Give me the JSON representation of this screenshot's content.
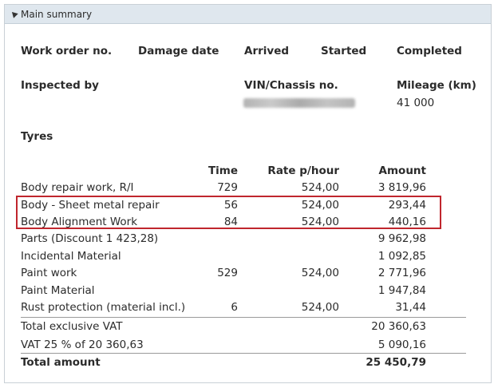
{
  "panel": {
    "title": "Main summary"
  },
  "header_fields": {
    "work_order": "Work order no.",
    "damage_date": "Damage date",
    "arrived": "Arrived",
    "started": "Started",
    "completed": "Completed",
    "inspected_by": "Inspected by",
    "vin": "VIN/Chassis no.",
    "mileage_label": "Mileage (km)",
    "mileage_value": "41 000"
  },
  "tyres_label": "Tyres",
  "columns": {
    "time": "Time",
    "rate": "Rate p/hour",
    "amount": "Amount"
  },
  "rows": [
    {
      "label": "Body repair work, R/I",
      "time": "729",
      "rate": "524,00",
      "amount": "3 819,96"
    },
    {
      "label": "Body - Sheet metal repair",
      "time": "56",
      "rate": "524,00",
      "amount": "293,44"
    },
    {
      "label": "Body Alignment Work",
      "time": "84",
      "rate": "524,00",
      "amount": "440,16"
    },
    {
      "label": "Parts (Discount 1 423,28)",
      "time": "",
      "rate": "",
      "amount": "9 962,98"
    },
    {
      "label": "Incidental Material",
      "time": "",
      "rate": "",
      "amount": "1 092,85"
    },
    {
      "label": "Paint work",
      "time": "529",
      "rate": "524,00",
      "amount": "2 771,96"
    },
    {
      "label": "Paint Material",
      "time": "",
      "rate": "",
      "amount": "1 947,84"
    },
    {
      "label": "Rust protection (material incl.)",
      "time": "6",
      "rate": "524,00",
      "amount": "31,44"
    }
  ],
  "totals": [
    {
      "label": "Total exclusive VAT",
      "amount": "20 360,63"
    },
    {
      "label": "VAT 25 % of 20 360,63",
      "amount": "5 090,16"
    },
    {
      "label": "Total amount",
      "amount": "25 450,79"
    }
  ],
  "colors": {
    "header_bg": "#dfe7ee",
    "highlight": "#c0262d"
  },
  "icons": {
    "collapse": "collapse-triangle-icon"
  }
}
